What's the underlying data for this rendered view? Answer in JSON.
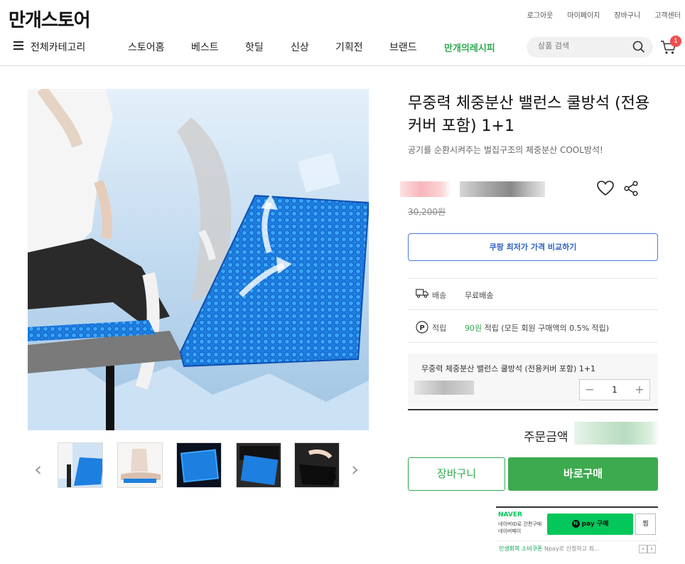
{
  "header": {
    "logo": "만개스토어",
    "util_links": [
      "로그아웃",
      "마이페이지",
      "장바구니",
      "고객센터"
    ],
    "category_label": "전체카테고리",
    "nav": [
      "스토어홈",
      "베스트",
      "핫딜",
      "신상",
      "기획전",
      "브랜드"
    ],
    "nav_special": "만개의레시피",
    "search_placeholder": "상품 검색",
    "cart_count": "1"
  },
  "product": {
    "title": "무중력 체중분산 밸런스 쿨방석 (전용커버 포함) 1+1",
    "subtitle": "공기를 순환시켜주는 벌집구조의 체중분산 COOL방석!",
    "original_price": "30,200원",
    "compare_button": "쿠팡 최저가 가격 비교하기",
    "shipping_label": "배송",
    "shipping_value": "무료배송",
    "points_label": "적립",
    "points_amount": "90원",
    "points_detail": " 적립 (모든 회원 구매액의 0.5% 적립)",
    "option_name": "무중력 체중분산 밸런스 쿨방석 (전용커버 포함) 1+1",
    "quantity": "1",
    "order_total_label": "주문금액",
    "cart_button": "장바구니",
    "buy_button": "바로구매"
  },
  "npay": {
    "brand": "NAVER",
    "desc_line1": "네이버ID로 간편구매",
    "desc_line2": "네이버페이",
    "button": "pay 구매",
    "zzim": "찜",
    "promo_highlight": "민생회복 소비쿠폰",
    "promo_text": " Npay로 신청하고 최…"
  },
  "colors": {
    "brand_green": "#2fa84f",
    "naver_green": "#03c75a",
    "compare_blue": "#2f62c4",
    "badge_red": "#f04e4e"
  }
}
